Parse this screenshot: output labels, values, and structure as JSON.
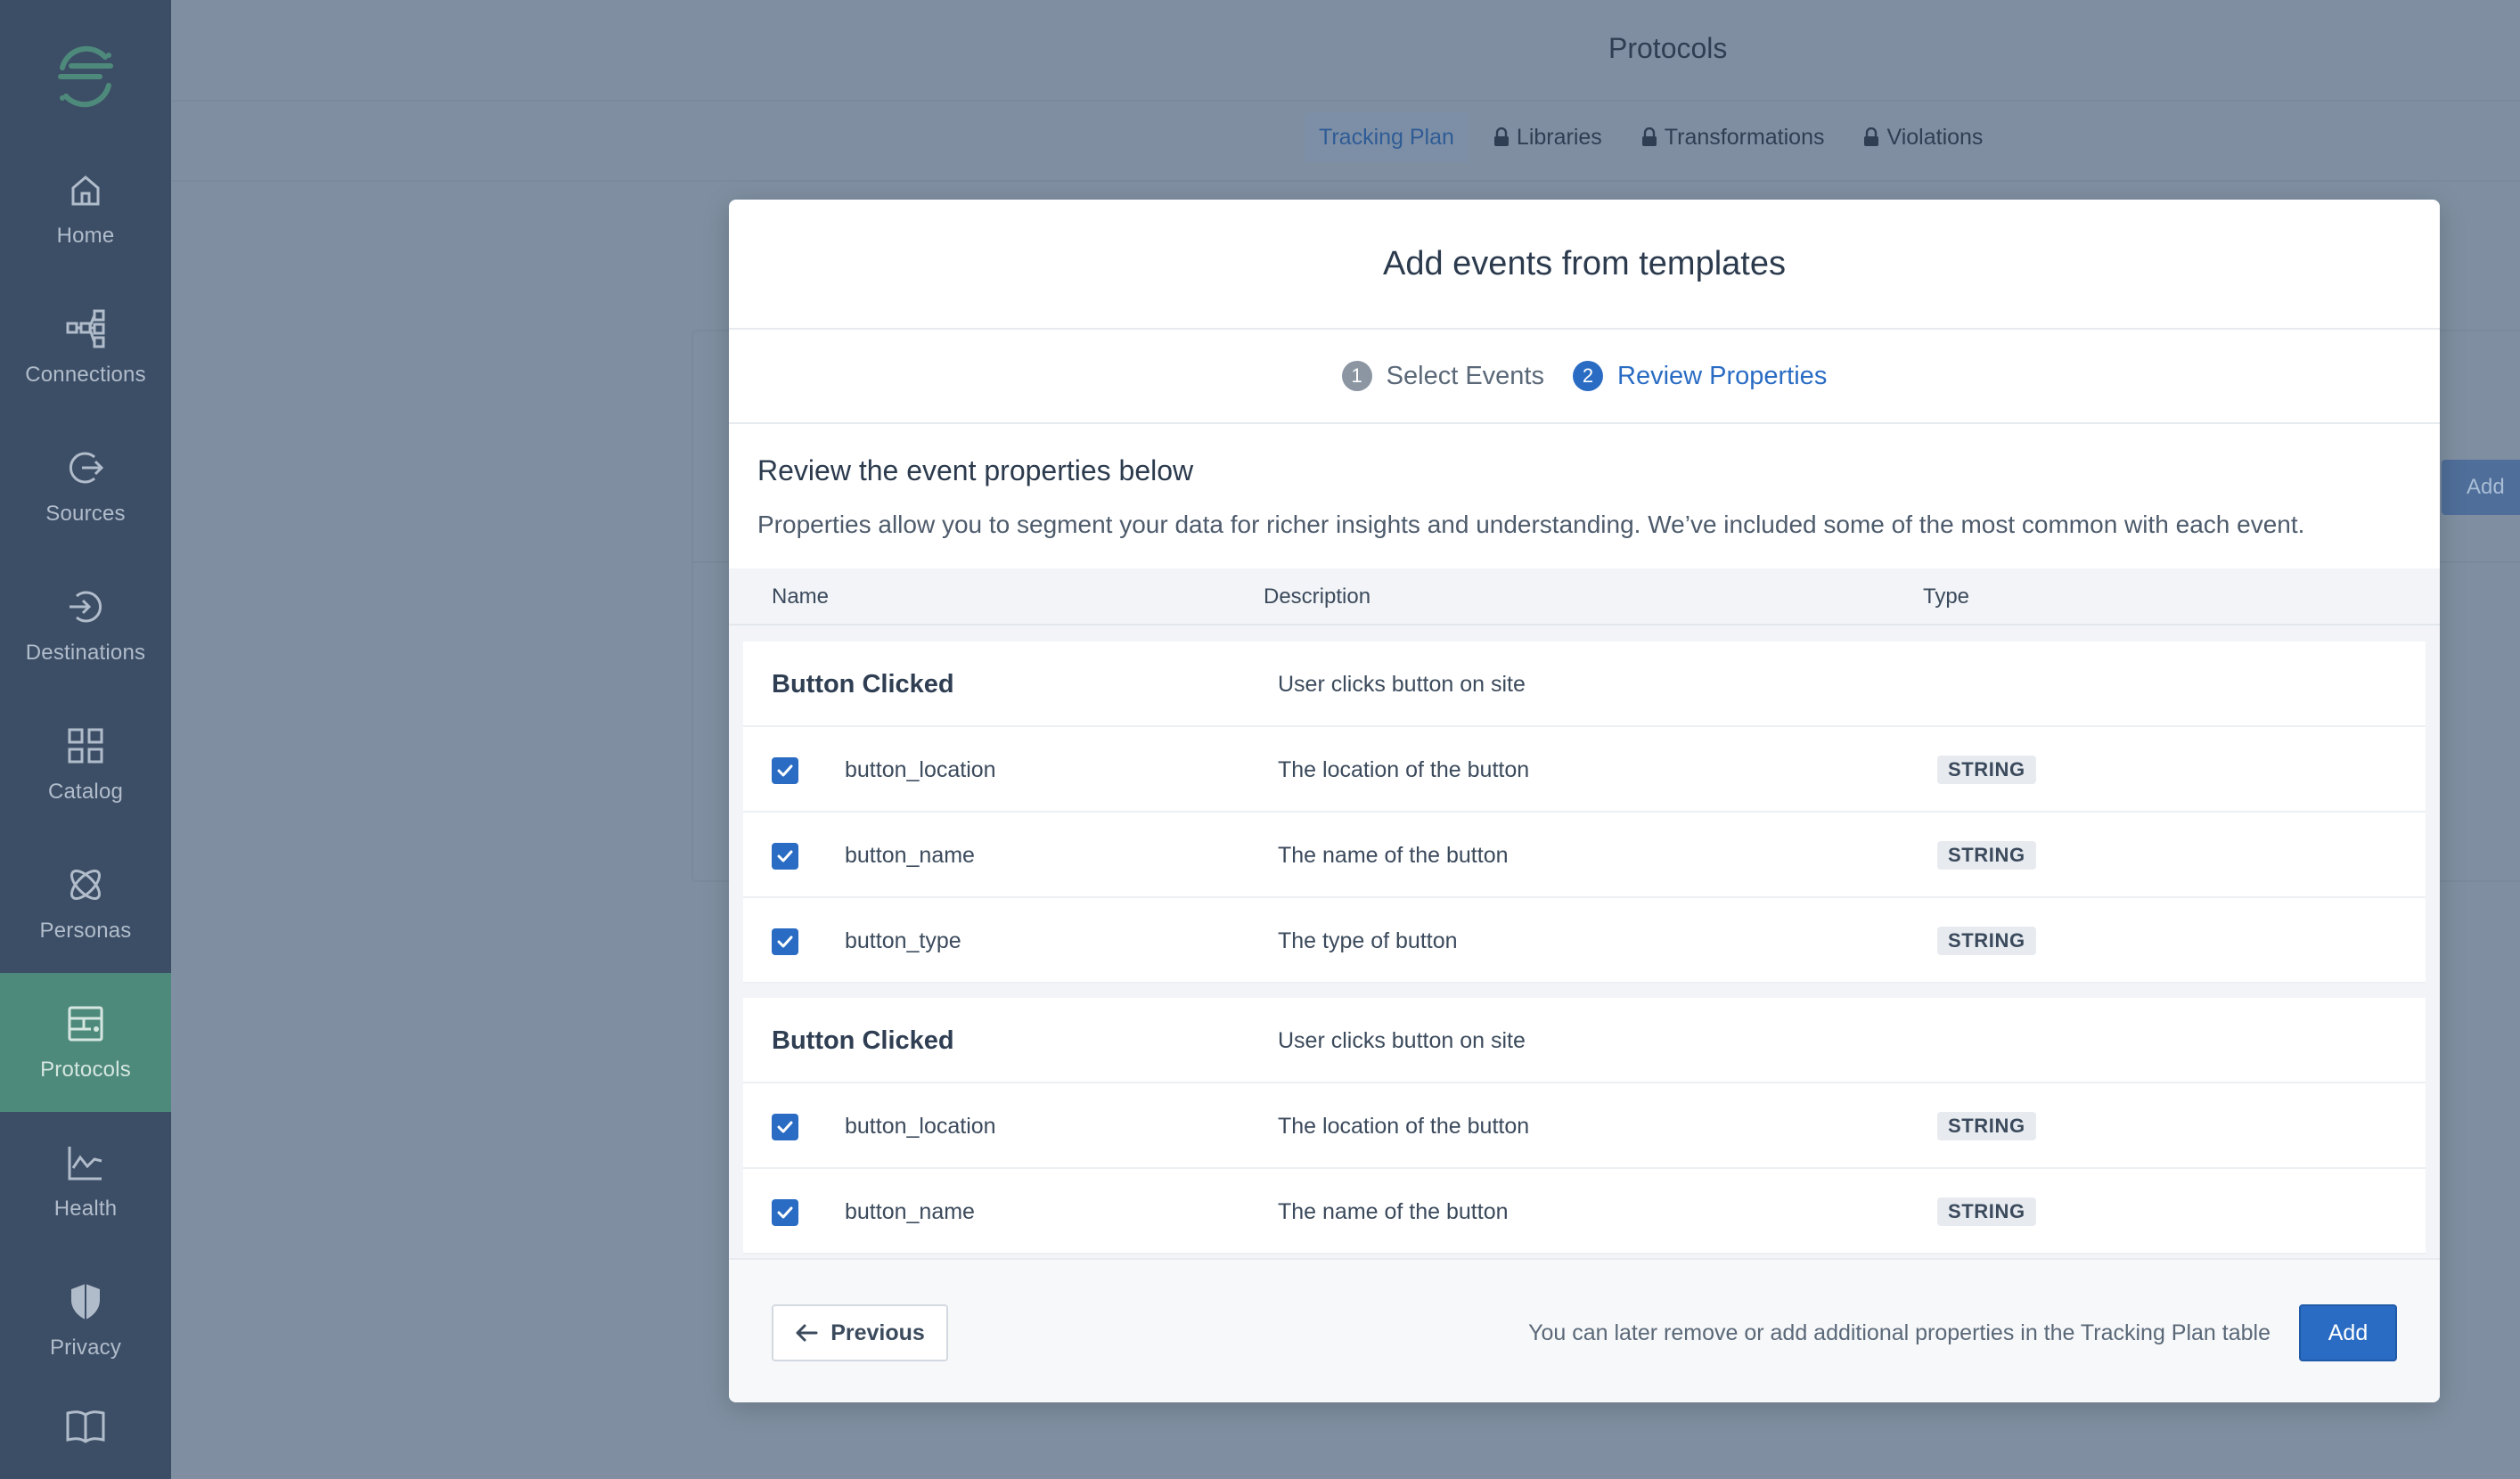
{
  "colors": {
    "sidebar_bg": "#3c4e66",
    "sidebar_active": "#4e8a7b",
    "accent": "#2a6cc4",
    "overlay_bg": "#7f8fa1"
  },
  "sidebar": {
    "items": [
      {
        "label": "Home",
        "icon": "home-icon"
      },
      {
        "label": "Connections",
        "icon": "connections-icon"
      },
      {
        "label": "Sources",
        "icon": "sources-icon"
      },
      {
        "label": "Destinations",
        "icon": "destinations-icon"
      },
      {
        "label": "Catalog",
        "icon": "catalog-icon"
      },
      {
        "label": "Personas",
        "icon": "personas-icon"
      },
      {
        "label": "Protocols",
        "icon": "protocols-icon",
        "active": true
      },
      {
        "label": "Health",
        "icon": "health-icon"
      },
      {
        "label": "Privacy",
        "icon": "privacy-icon"
      },
      {
        "label": "",
        "icon": "docs-book-icon"
      }
    ]
  },
  "page": {
    "title": "Protocols",
    "tabs": [
      {
        "label": "Tracking Plan",
        "active": true,
        "locked": false
      },
      {
        "label": "Libraries",
        "locked": true
      },
      {
        "label": "Transformations",
        "locked": true
      },
      {
        "label": "Violations",
        "locked": true
      }
    ],
    "add_button_label": "Add"
  },
  "modal": {
    "title": "Add events from templates",
    "steps": [
      {
        "number": "1",
        "label": "Select Events",
        "active": false
      },
      {
        "number": "2",
        "label": "Review Properties",
        "active": true
      }
    ],
    "intro_title": "Review the event properties below",
    "intro_desc": "Properties allow you to segment your data for richer insights and understanding. We’ve included some of the most common with each event.",
    "columns": {
      "name": "Name",
      "description": "Description",
      "type": "Type"
    },
    "groups": [
      {
        "event_name": "Button Clicked",
        "event_desc": "User clicks button on site",
        "properties": [
          {
            "name": "button_location",
            "description": "The location of the button",
            "type": "STRING",
            "checked": true
          },
          {
            "name": "button_name",
            "description": "The name of the button",
            "type": "STRING",
            "checked": true
          },
          {
            "name": "button_type",
            "description": "The type of button",
            "type": "STRING",
            "checked": true
          }
        ]
      },
      {
        "event_name": "Button Clicked",
        "event_desc": "User clicks button on site",
        "properties": [
          {
            "name": "button_location",
            "description": "The location of the button",
            "type": "STRING",
            "checked": true
          },
          {
            "name": "button_name",
            "description": "The name of the button",
            "type": "STRING",
            "checked": true
          }
        ]
      }
    ],
    "footer": {
      "previous_label": "Previous",
      "note": "You can later remove or add additional properties in the Tracking Plan table",
      "add_label": "Add"
    }
  }
}
